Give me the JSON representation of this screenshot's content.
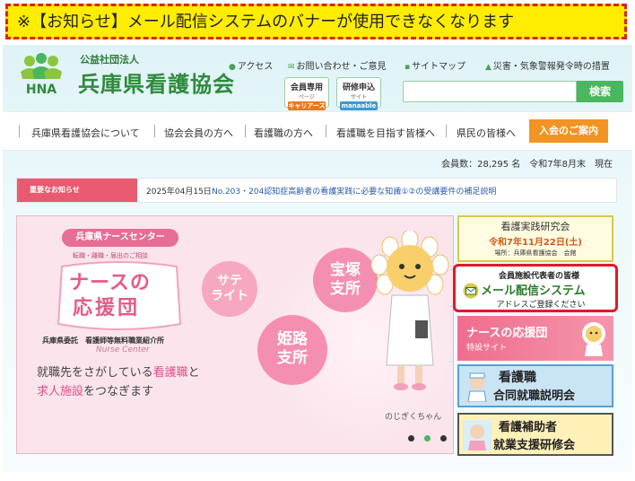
{
  "notice": {
    "text": "※【お知らせ】メール配信システムのバナーが使用できなくなります"
  },
  "header": {
    "logo_text": "HNA",
    "org_small": "公益社団法人",
    "org_name": "兵庫県看護協会",
    "top_links": [
      "アクセス",
      "お問い合わせ・ご意見",
      "サイトマップ",
      "災害・気象警報発令時の措置"
    ],
    "member_btn": {
      "line1": "会員専用",
      "line2": "ページ",
      "pill": "キャリアース"
    },
    "training_btn": {
      "line1": "研修申込",
      "line2": "サイト",
      "pill": "manaable"
    },
    "search_placeholder": "",
    "search_label": "検索"
  },
  "nav": {
    "items": [
      "兵庫県看護協会について",
      "協会会員の方へ",
      "看護職の方へ",
      "看護職を目指す皆様へ",
      "県民の皆様へ"
    ],
    "join": "入会のご案内"
  },
  "members": {
    "text": "会員数：28,295 名　令和7年8月末　現在"
  },
  "news": {
    "badge": "重要なお知らせ",
    "date": "2025年04月15日",
    "title": "No.203・204認知症高齢者の看護実践に必要な知識①②の受講要件の補足説明"
  },
  "slide": {
    "center_title": "兵庫県ナースセンター",
    "center_sub": "転職・離職・届出のご相談",
    "oendan_line1": "ナースの",
    "oendan_line2": "応援団",
    "bubble1": [
      "サテ",
      "ライト"
    ],
    "bubble2": [
      "宝塚",
      "支所"
    ],
    "bubble3": [
      "姫路",
      "支所"
    ],
    "commission": "兵庫県委託　看護師等無料職業紹介所",
    "nurse_center": "Nurse Center",
    "tag1_pre": "就職先をさがしている",
    "tag1_hl": "看護職",
    "tag1_post": "と",
    "tag2_hl": "求人施設",
    "tag2_post": "をつなぎます",
    "mascot_name": "のじぎくちゃん"
  },
  "banners": {
    "research": {
      "title": "看護実践研究会",
      "date": "令和7年11月22日(土)",
      "place": "場所：兵庫県看護協会　会館"
    },
    "mail": {
      "line1": "会員施設代表者の皆様",
      "line2": "メール配信システム",
      "line3": "アドレスご登録ください"
    },
    "ouendan": {
      "title": "ナースの応援団",
      "sub": "特設サイト"
    },
    "job_fair": {
      "line1": "看護職",
      "line2": "合同就職説明会"
    },
    "assistant": {
      "line1": "看護補助者",
      "line2": "就業支援研修会"
    }
  },
  "colors": {
    "accent_green": "#4ab65e",
    "notice_bg": "#ffed00",
    "notice_border": "#e02020",
    "join_orange": "#f29423",
    "news_pink": "#e9596f"
  }
}
